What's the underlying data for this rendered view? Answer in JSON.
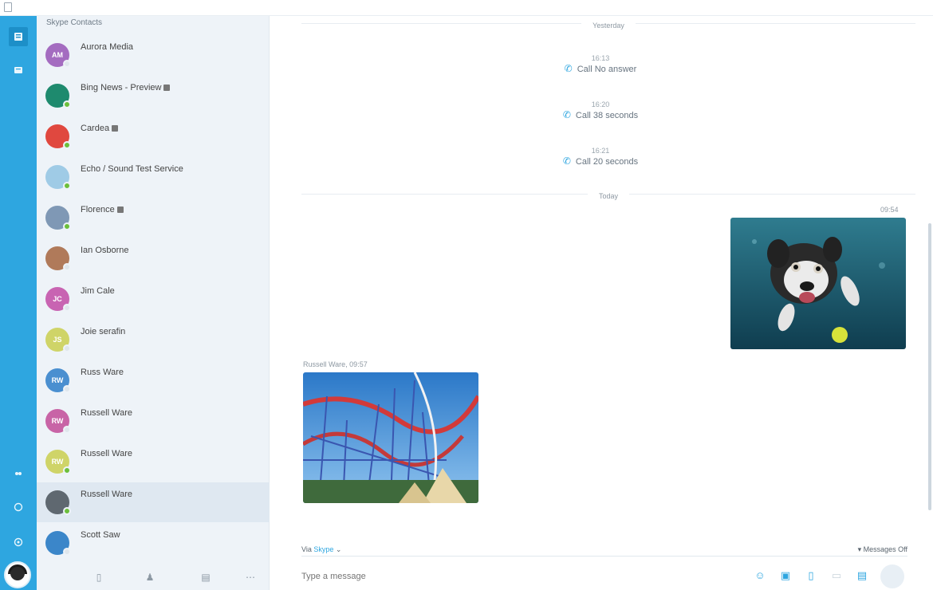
{
  "colors": {
    "accent": "#2ea6e0",
    "online": "#6cbf3b",
    "sidebar": "#eef3f8",
    "rail": "#2ea6e0"
  },
  "sidebar": {
    "title": "Skype Contacts",
    "contacts": [
      {
        "name": "Aurora Media",
        "initials": "AM",
        "color": "#a46cc0",
        "online": false,
        "tag": false
      },
      {
        "name": "Bing News - Preview",
        "initials": "",
        "color": "#1e8a6e",
        "online": true,
        "tag": true
      },
      {
        "name": "Cardea",
        "initials": "",
        "color": "#e0483f",
        "online": true,
        "tag": true
      },
      {
        "name": "Echo / Sound Test Service",
        "initials": "",
        "color": "#9fcbe6",
        "online": true,
        "tag": false
      },
      {
        "name": "Florence",
        "initials": "",
        "color": "#7f98b5",
        "online": true,
        "tag": true
      },
      {
        "name": "Ian Osborne",
        "initials": "",
        "color": "#b07a5a",
        "online": false,
        "tag": false
      },
      {
        "name": "Jim Cale",
        "initials": "JC",
        "color": "#c864b2",
        "online": false,
        "tag": false
      },
      {
        "name": "Joie serafin",
        "initials": "JS",
        "color": "#cfd468",
        "online": false,
        "tag": false
      },
      {
        "name": "Russ Ware",
        "initials": "RW",
        "color": "#4a8fd0",
        "online": false,
        "tag": false
      },
      {
        "name": "Russell Ware",
        "initials": "RW",
        "color": "#c864a6",
        "online": false,
        "tag": false
      },
      {
        "name": "Russell Ware",
        "initials": "RW",
        "color": "#cfd468",
        "online": true,
        "tag": false
      },
      {
        "name": "Russell Ware",
        "initials": "",
        "color": "#5f6870",
        "online": true,
        "tag": false,
        "selected": true
      },
      {
        "name": "Scott Saw",
        "initials": "",
        "color": "#3b86c9",
        "online": false,
        "tag": false
      }
    ],
    "bottom_icons": [
      "dialpad-icon",
      "add-contact-icon",
      "new-group-icon",
      "more-icon"
    ]
  },
  "chat": {
    "yesterday_label": "Yesterday",
    "today_label": "Today",
    "calls": [
      {
        "time": "16:13",
        "text": "Call No answer"
      },
      {
        "time": "16:20",
        "text": "Call 38 seconds"
      },
      {
        "time": "16:21",
        "text": "Call 20 seconds"
      }
    ],
    "my_photo_time": "09:54",
    "their_photo_meta": "Russell Ware, 09:57",
    "composer": {
      "via_prefix": "Via",
      "via_link": "Skype",
      "messages_off": "Messages Off",
      "placeholder": "Type a message"
    }
  }
}
